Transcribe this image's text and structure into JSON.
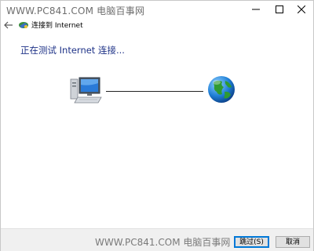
{
  "watermark": {
    "top": "WWW.PC841.COM 电脑百事网",
    "bottom": "WWW.PC841.COM 电脑百事网"
  },
  "window_controls": {
    "minimize": "minimize-icon",
    "maximize": "maximize-icon",
    "close": "close-icon"
  },
  "nav": {
    "back_icon": "back-arrow-icon",
    "icon": "network-connection-icon",
    "title": "连接到 Internet"
  },
  "main": {
    "heading": "正在测试 Internet 连接...",
    "computer_icon": "computer-icon",
    "globe_icon": "globe-icon"
  },
  "footer": {
    "skip_label": "跳过(S)",
    "cancel_label": "取消"
  },
  "colors": {
    "heading": "#1e3287",
    "default_button_border": "#0078d7"
  }
}
